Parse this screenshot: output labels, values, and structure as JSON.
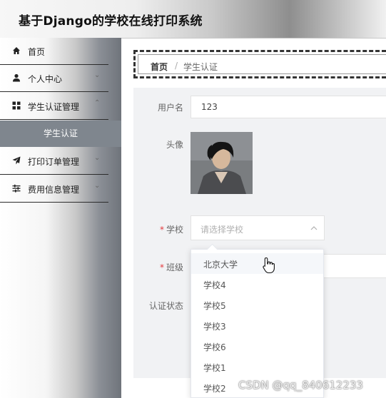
{
  "header": {
    "title": "基于Django的学校在线打印系统"
  },
  "sidebar": {
    "items": [
      {
        "label": "首页",
        "icon": "home-icon"
      },
      {
        "label": "个人中心",
        "icon": "user-icon"
      },
      {
        "label": "学生认证管理",
        "icon": "grid-icon"
      },
      {
        "label": "学生认证",
        "icon": ""
      },
      {
        "label": "打印订单管理",
        "icon": "paper-plane-icon"
      },
      {
        "label": "费用信息管理",
        "icon": "sliders-icon"
      }
    ]
  },
  "breadcrumb": {
    "home": "首页",
    "separator": "/",
    "current": "学生认证"
  },
  "form": {
    "username_label": "用户名",
    "username_value": "123",
    "avatar_label": "头像",
    "school_label": "学校",
    "school_placeholder": "请选择学校",
    "class_label": "班级",
    "status_label": "认证状态",
    "required_mark": "*"
  },
  "dropdown": {
    "options": [
      "北京大学",
      "学校4",
      "学校5",
      "学校3",
      "学校6",
      "学校1",
      "学校2"
    ]
  },
  "watermark": "CSDN @qq_840612233",
  "colors": {
    "active_nav": "#7f868e",
    "required": "#e4393c"
  }
}
